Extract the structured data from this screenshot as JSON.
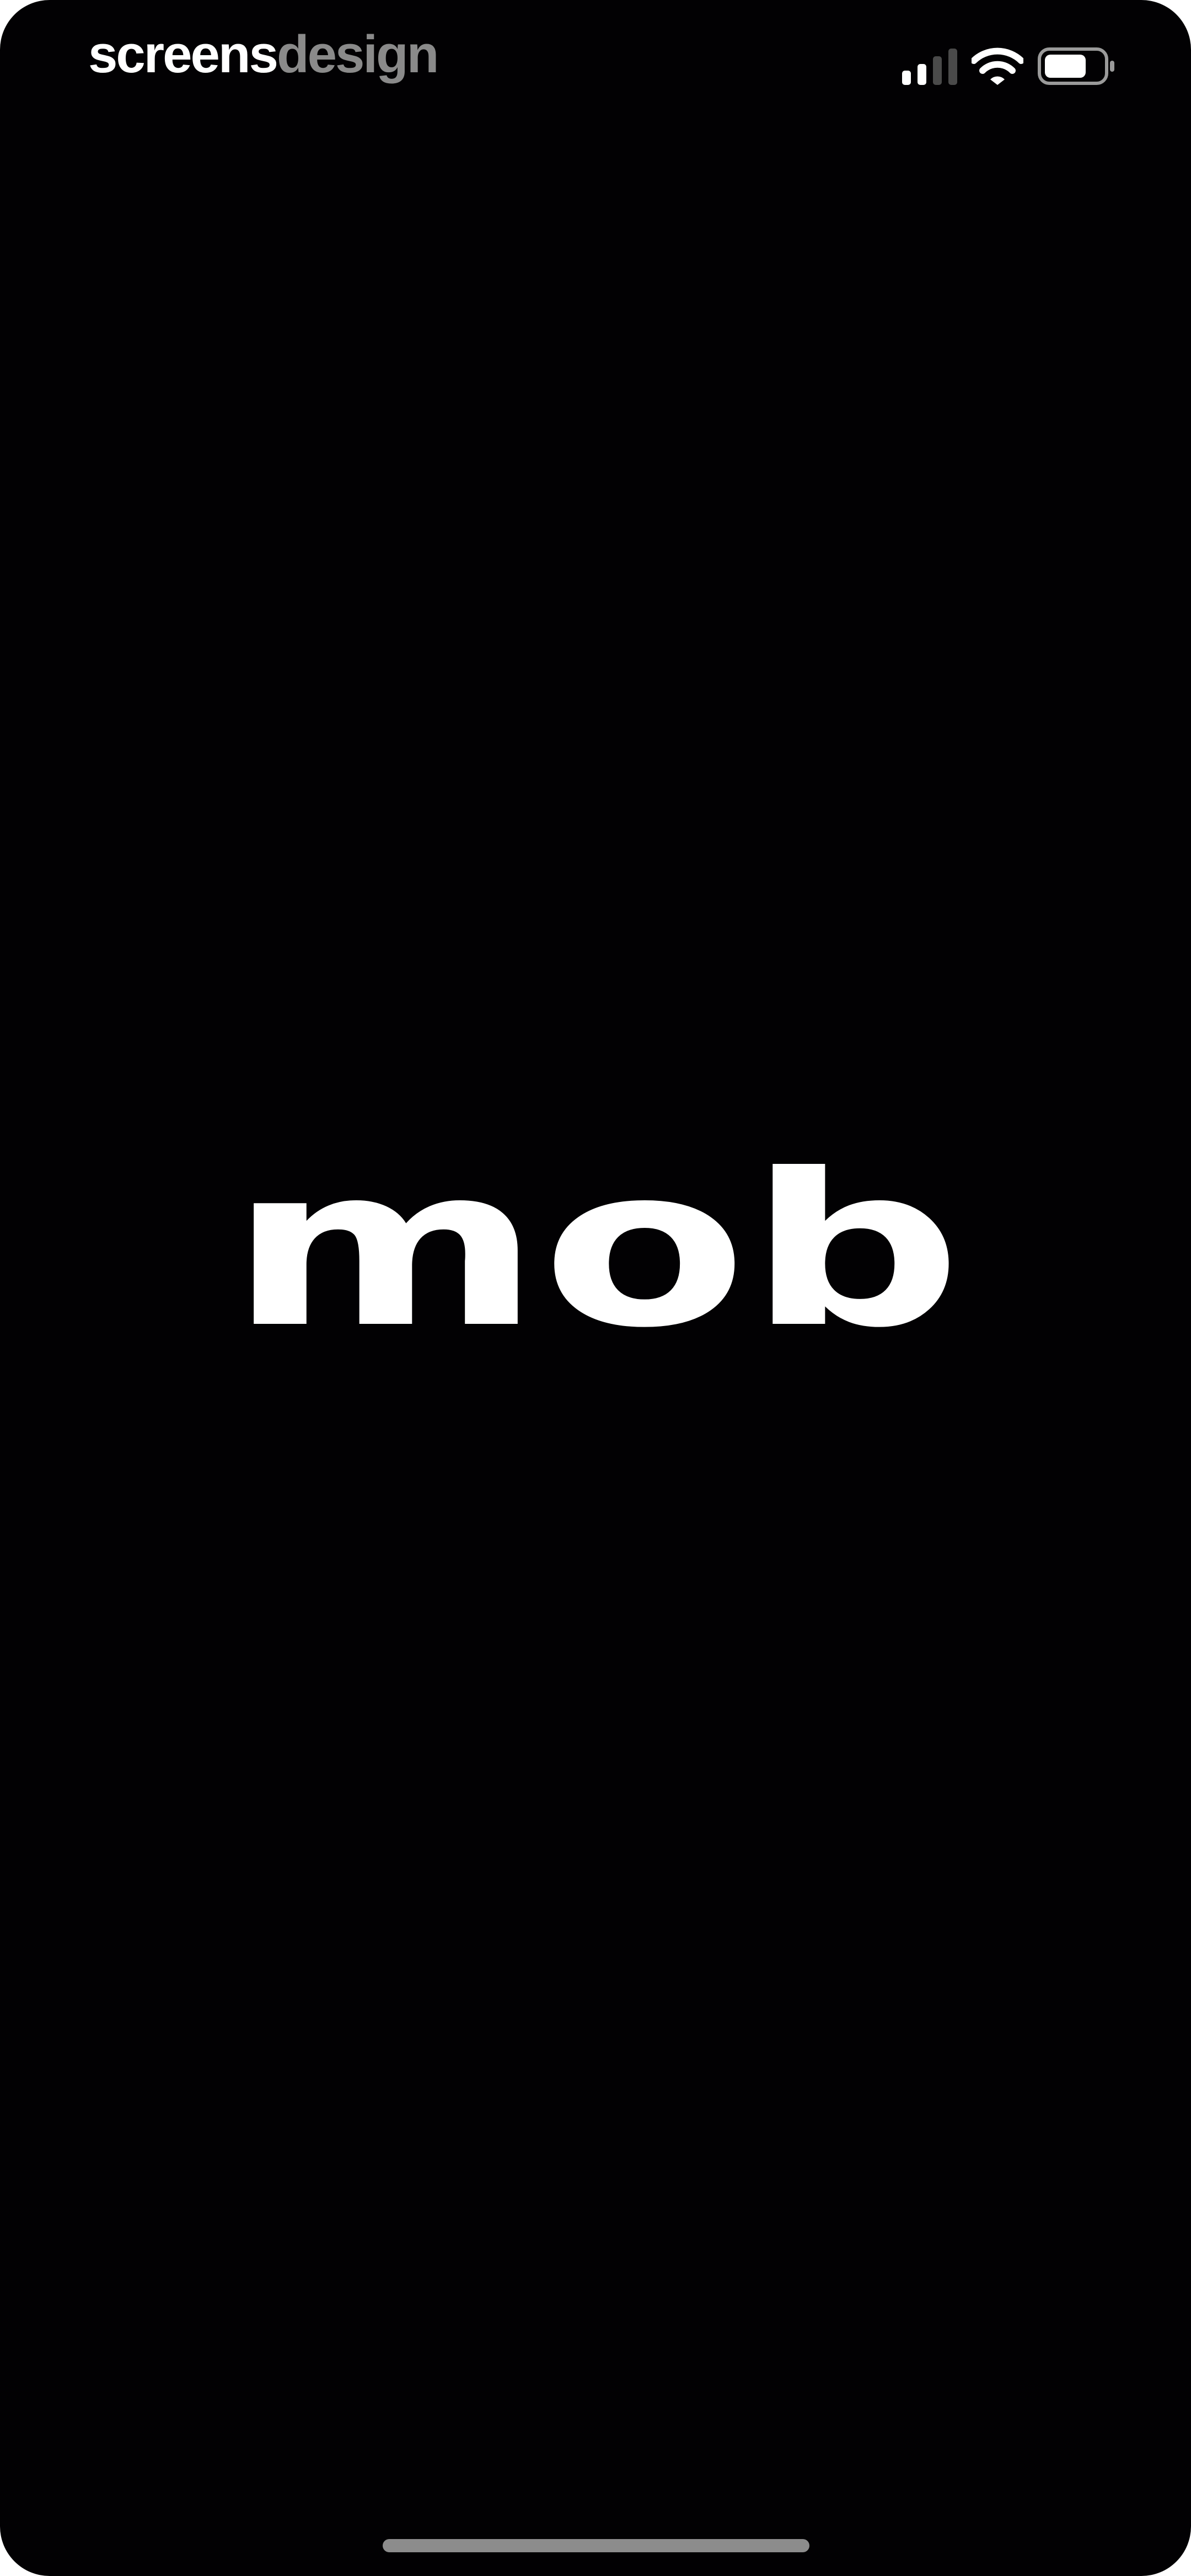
{
  "watermark": {
    "part1": "screens",
    "part2": "design"
  },
  "status_bar": {
    "signal_icon": "cellular-signal-icon",
    "signal_bars_active": 2,
    "signal_bars_total": 4,
    "wifi_icon": "wifi-icon",
    "battery_icon": "battery-icon"
  },
  "splash": {
    "logo_text": "mob",
    "background_color": "#020103",
    "logo_color": "#ffffff"
  },
  "home_indicator": {
    "icon": "home-indicator"
  }
}
